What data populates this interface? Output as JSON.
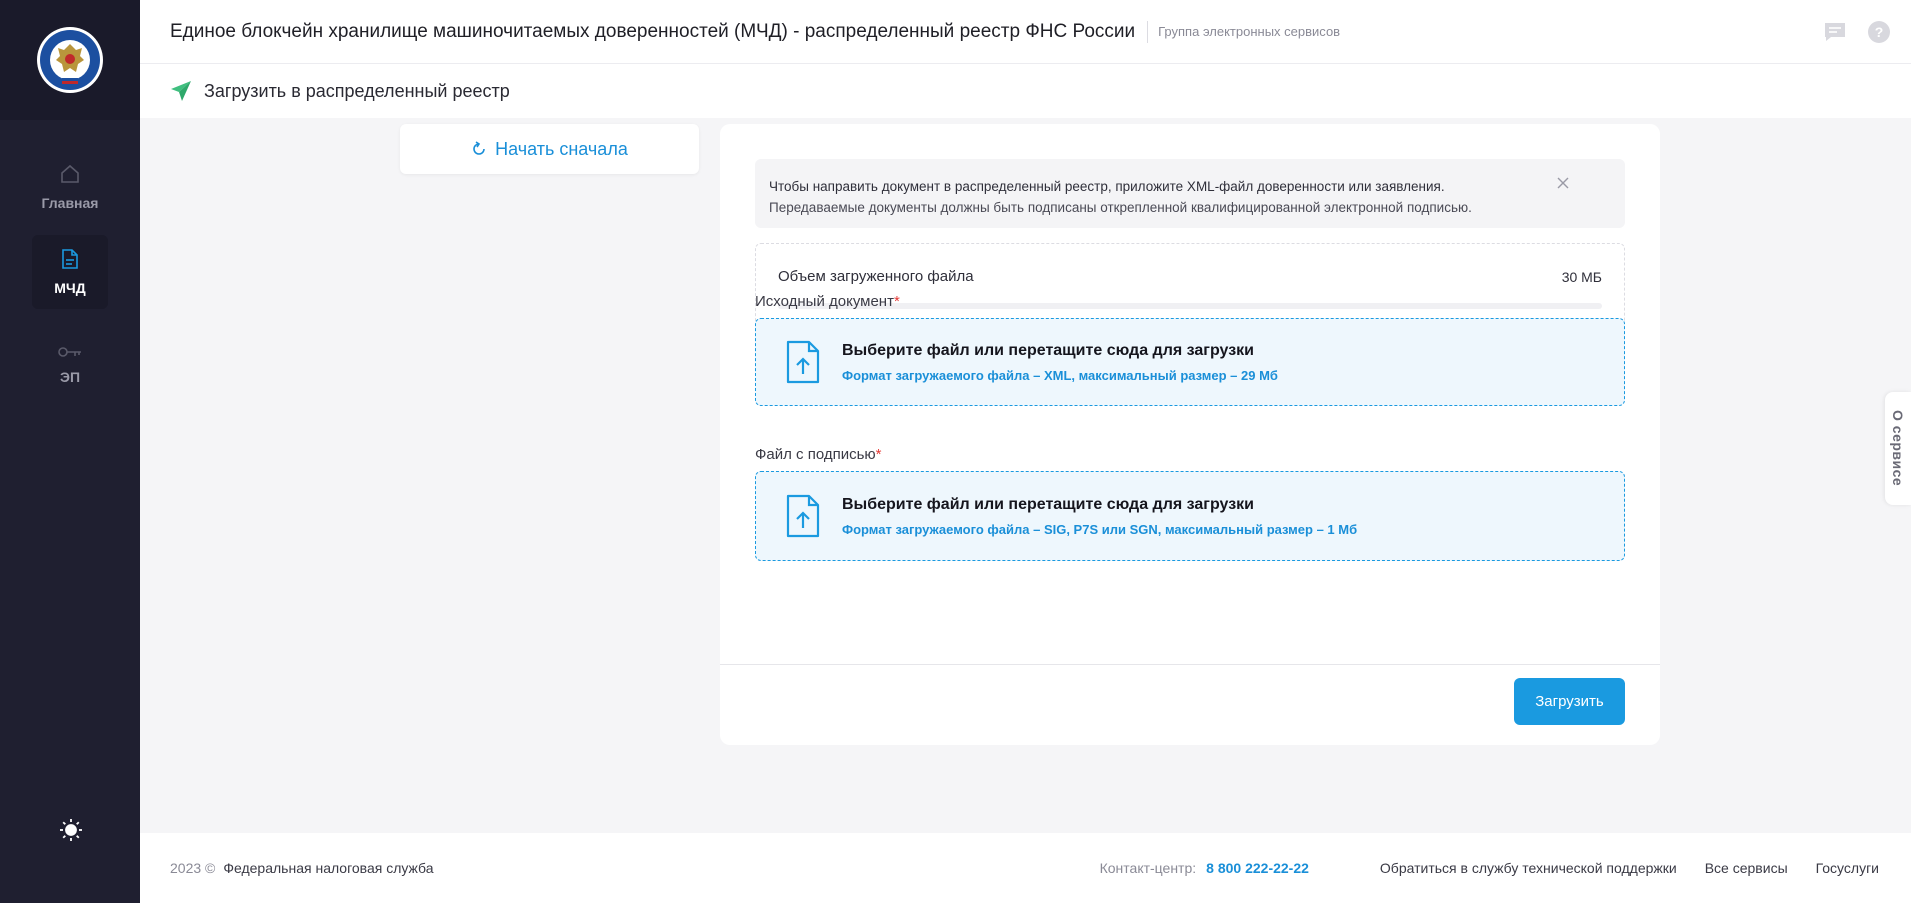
{
  "header": {
    "title": "Единое блокчейн хранилище машиночитаемых доверенностей (МЧД) - распределенный реестр ФНС России",
    "subtitle": "Группа электронных сервисов",
    "icons": [
      "chat-icon",
      "help-icon"
    ]
  },
  "subheader": {
    "title": "Загрузить в распределенный реестр",
    "icon": "send-icon"
  },
  "sidebar": {
    "items": [
      {
        "label": "Главная",
        "icon": "home-icon",
        "active": false
      },
      {
        "label": "МЧД",
        "icon": "document-icon",
        "active": true
      },
      {
        "label": "ЭП",
        "icon": "key-icon",
        "active": false
      }
    ],
    "theme_icon": "sun-icon"
  },
  "restart": {
    "label": "Начать сначала",
    "icon": "refresh-icon"
  },
  "info": {
    "line1": "Чтобы направить документ в распределенный реестр, приложите XML-файл доверенности или заявления.",
    "line2": "Передаваемые документы должны быть подписаны открепленной квалифицированной электронной подписью."
  },
  "volume": {
    "label": "Объем загруженного файла",
    "value": "30 МБ",
    "progress_percent": 0
  },
  "source_doc": {
    "label": "Исходный документ",
    "required_mark": "*",
    "title": "Выберите файл или перетащите сюда для загрузки",
    "hint": "Формат загружаемого файла – XML, максимальный размер – 29 Мб"
  },
  "signature_file": {
    "label": "Файл с подписью",
    "required_mark": "*",
    "title": "Выберите файл или перетащите сюда для загрузки",
    "hint": "Формат загружаемого файла – SIG, P7S или SGN, максимальный размер – 1 Мб"
  },
  "upload_button": {
    "label": "Загрузить"
  },
  "footer": {
    "year": "2023 ©",
    "org": "Федеральная налоговая служба",
    "contact_label": "Контакт-центр:",
    "phone": "8 800 222-22-22",
    "links": [
      "Обратиться в службу технической поддержки",
      "Все сервисы",
      "Госуслуги"
    ]
  },
  "side_tab": {
    "label": "О сервисе"
  },
  "colors": {
    "accent": "#1a9ae0",
    "sidebar_bg": "#1f1f30",
    "required": "#e53935"
  }
}
